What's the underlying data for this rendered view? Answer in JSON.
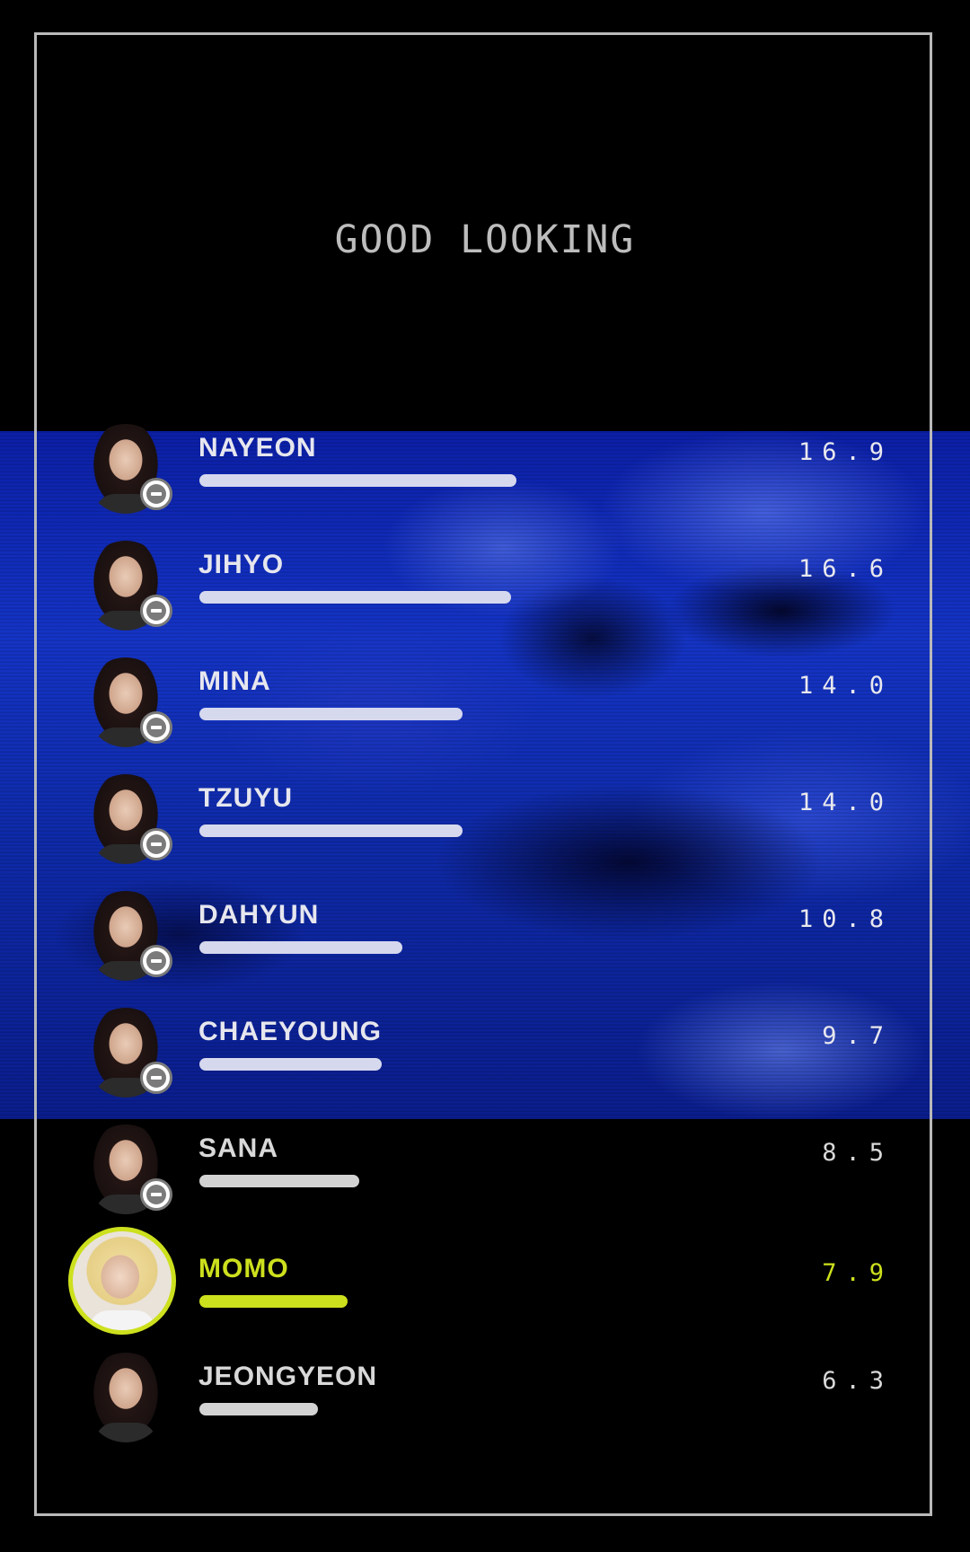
{
  "title": "GOOD LOOKING",
  "accent_color": "#cde01d",
  "rank_list": [
    {
      "name": "NAYEON",
      "score": "16.9",
      "value": 16.9,
      "icon": "remove-icon",
      "highlight": false
    },
    {
      "name": "JIHYO",
      "score": "16.6",
      "value": 16.6,
      "icon": "remove-icon",
      "highlight": false
    },
    {
      "name": "MINA",
      "score": "14.0",
      "value": 14.0,
      "icon": "remove-icon",
      "highlight": false
    },
    {
      "name": "TZUYU",
      "score": "14.0",
      "value": 14.0,
      "icon": "remove-icon",
      "highlight": false
    },
    {
      "name": "DAHYUN",
      "score": "10.8",
      "value": 10.8,
      "icon": "remove-icon",
      "highlight": false
    },
    {
      "name": "CHAEYOUNG",
      "score": "9.7",
      "value": 9.7,
      "icon": "remove-icon",
      "highlight": false
    },
    {
      "name": "SANA",
      "score": "8.5",
      "value": 8.5,
      "icon": "remove-icon",
      "highlight": false
    },
    {
      "name": "MOMO",
      "score": "7.9",
      "value": 7.9,
      "icon": "",
      "highlight": true
    },
    {
      "name": "JEONGYEON",
      "score": "6.3",
      "value": 6.3,
      "icon": "",
      "highlight": false
    }
  ]
}
